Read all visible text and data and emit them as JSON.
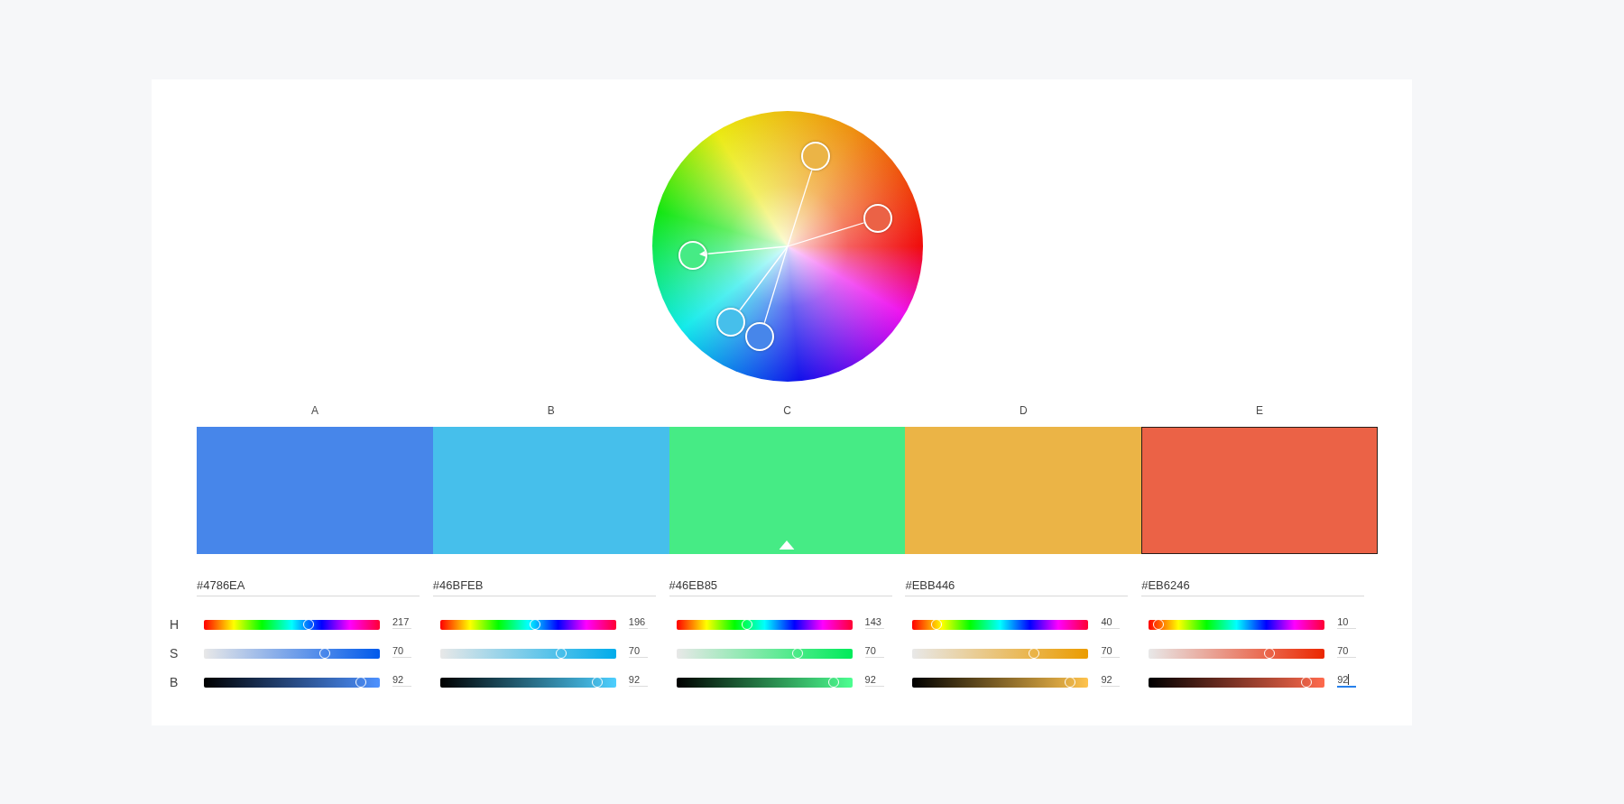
{
  "swatches": [
    {
      "label": "A",
      "color": "#4786ea",
      "hex": "#4786EA",
      "base": false,
      "selected": false,
      "values": [
        {
          "value": "217",
          "level": 0.6028,
          "focused": false
        },
        {
          "value": "70",
          "level": 0.7,
          "focused": false
        },
        {
          "value": "92",
          "level": 0.92,
          "focused": false
        }
      ]
    },
    {
      "label": "B",
      "color": "#46bfeb",
      "hex": "#46BFEB",
      "base": false,
      "selected": false,
      "values": [
        {
          "value": "196",
          "level": 0.5444,
          "focused": false
        },
        {
          "value": "70",
          "level": 0.7,
          "focused": false
        },
        {
          "value": "92",
          "level": 0.92,
          "focused": false
        }
      ]
    },
    {
      "label": "C",
      "color": "#46eb85",
      "hex": "#46EB85",
      "base": true,
      "selected": false,
      "values": [
        {
          "value": "143",
          "level": 0.3972,
          "focused": false
        },
        {
          "value": "70",
          "level": 0.7,
          "focused": false
        },
        {
          "value": "92",
          "level": 0.92,
          "focused": false
        }
      ]
    },
    {
      "label": "D",
      "color": "#ebb446",
      "hex": "#EBB446",
      "base": false,
      "selected": false,
      "values": [
        {
          "value": "40",
          "level": 0.1111,
          "focused": false
        },
        {
          "value": "70",
          "level": 0.7,
          "focused": false
        },
        {
          "value": "92",
          "level": 0.92,
          "focused": false
        }
      ]
    },
    {
      "label": "E",
      "color": "#eb6246",
      "hex": "#EB6246",
      "base": false,
      "selected": true,
      "values": [
        {
          "value": "10",
          "level": 0.0278,
          "focused": false
        },
        {
          "value": "70",
          "level": 0.7,
          "focused": false
        },
        {
          "value": "92",
          "level": 0.92,
          "focused": true
        }
      ]
    }
  ],
  "channels": [
    {
      "label": "H",
      "kind": "hue"
    },
    {
      "label": "S",
      "kind": "saturation"
    },
    {
      "label": "B",
      "kind": "brightness"
    }
  ]
}
